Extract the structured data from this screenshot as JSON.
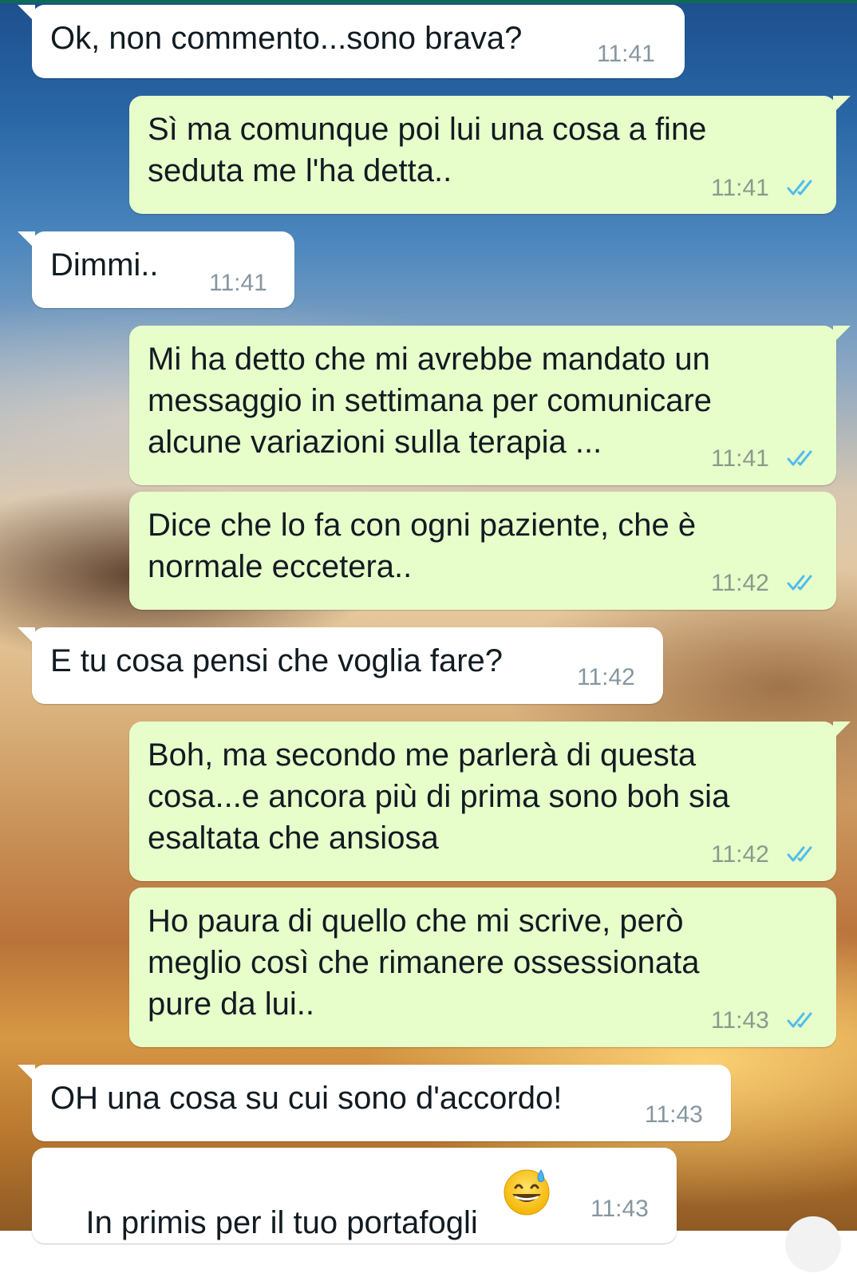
{
  "messages": [
    {
      "id": "m1",
      "direction": "in",
      "text": "Ok, non commento...sono brava?",
      "time": "11:41"
    },
    {
      "id": "m2",
      "direction": "out",
      "text": "Sì ma comunque poi lui una cosa a fine\nseduta me l'ha detta..",
      "time": "11:41",
      "status": "read"
    },
    {
      "id": "m3",
      "direction": "in",
      "text": "Dimmi..",
      "time": "11:41"
    },
    {
      "id": "m4",
      "direction": "out",
      "text": "Mi ha detto che mi avrebbe mandato un\nmessaggio in settimana per comunicare\nalcune variazioni sulla terapia ...",
      "time": "11:41",
      "status": "read"
    },
    {
      "id": "m5",
      "direction": "out",
      "text": "Dice che lo fa con ogni paziente, che è\nnormale eccetera..",
      "time": "11:42",
      "status": "read"
    },
    {
      "id": "m6",
      "direction": "in",
      "text": "E tu cosa pensi che voglia fare?",
      "time": "11:42"
    },
    {
      "id": "m7",
      "direction": "out",
      "text": "Boh, ma secondo me parlerà di questa\ncosa...e ancora più di prima sono boh sia\nesaltata che ansiosa",
      "time": "11:42",
      "status": "read"
    },
    {
      "id": "m8",
      "direction": "out",
      "text": "Ho paura di quello che mi scrive, però\nmeglio così che rimanere ossessionata\npure da lui..",
      "time": "11:43",
      "status": "read"
    },
    {
      "id": "m9",
      "direction": "in",
      "text": "OH una cosa su cui sono d'accordo!",
      "time": "11:43"
    },
    {
      "id": "m10",
      "direction": "in",
      "text": "In primis per il tuo portafogli",
      "time": "11:43",
      "emoji": "grinning-face-with-sweat-emoji"
    }
  ],
  "colors": {
    "incoming_bubble": "#ffffff",
    "outgoing_bubble": "#e7fecb",
    "read_ticks": "#53bdeb",
    "timestamp": "#8696a0"
  }
}
